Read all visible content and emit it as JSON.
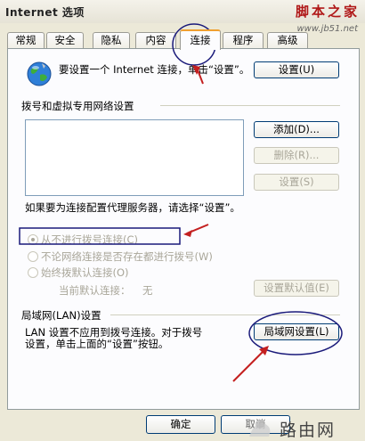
{
  "window": {
    "title": "Internet 选项",
    "watermark_main": "脚本之家",
    "watermark_url": "www.jb51.net"
  },
  "tabs": [
    {
      "label": "常规"
    },
    {
      "label": "安全"
    },
    {
      "label": "隐私"
    },
    {
      "label": "内容"
    },
    {
      "label": "连接",
      "active": true
    },
    {
      "label": "程序"
    },
    {
      "label": "高级"
    }
  ],
  "setup": {
    "text": "要设置一个 Internet 连接，单击“设置”。",
    "button": "设置(U)"
  },
  "dialup": {
    "group_title": "拨号和虚拟专用网络设置",
    "add_button": "添加(D)...",
    "remove_button": "删除(R)...",
    "settings_button": "设置(S)",
    "proxy_text": "如果要为连接配置代理服务器，请选择“设置”。",
    "options": [
      {
        "label": "从不进行拨号连接(C)",
        "selected": true
      },
      {
        "label": "不论网络连接是否存在都进行拨号(W)",
        "selected": false
      },
      {
        "label": "始终拨默认连接(O)",
        "selected": false
      }
    ],
    "current_default_label": "当前默认连接：",
    "current_default_value": "无",
    "set_default_button": "设置默认值(E)"
  },
  "lan": {
    "group_title": "局域网(LAN)设置",
    "text_line1": "LAN 设置不应用到拨号连接。对于拨号",
    "text_line2": "设置，单击上面的“设置”按钮。",
    "button": "局域网设置(L)"
  },
  "footer": {
    "ok_button": "确定",
    "cancel_button": "取消",
    "logo_text": "路由网"
  },
  "colors": {
    "annotation": "#1a1a7a",
    "arrow": "#c42020",
    "watermark": "#b01818"
  }
}
